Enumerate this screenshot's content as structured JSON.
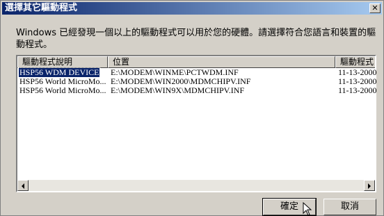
{
  "window": {
    "title": "選擇其它驅動程式"
  },
  "description": "Windows 已經發現一個以上的驅動程式可以用於您的硬體。請選擇符合您語言和裝置的驅動程式。",
  "list": {
    "columns": [
      "驅動程式說明",
      "位置",
      "驅動程式日期"
    ],
    "rows": [
      {
        "description": "HSP56 WDM DEVICE",
        "location": "E:\\MODEM\\WINME\\PCTWDM.INF",
        "date": "11-13-2000",
        "selected": true
      },
      {
        "description": "HSP56 World MicroMo...",
        "location": "E:\\MODEM\\WIN2000\\MDMCHIPV.INF",
        "date": "11-13-2000",
        "selected": false
      },
      {
        "description": "HSP56 World MicroMo...",
        "location": "E:\\MODEM\\WIN9X\\MDMCHIPV.INF",
        "date": "11-13-2000",
        "selected": false
      }
    ]
  },
  "buttons": {
    "ok": "確定",
    "cancel": "取消"
  },
  "icons": {
    "close": "close-icon",
    "scroll_left": "scroll-left-arrow-icon",
    "scroll_right": "scroll-right-arrow-icon",
    "cursor": "mouse-pointer-icon"
  }
}
